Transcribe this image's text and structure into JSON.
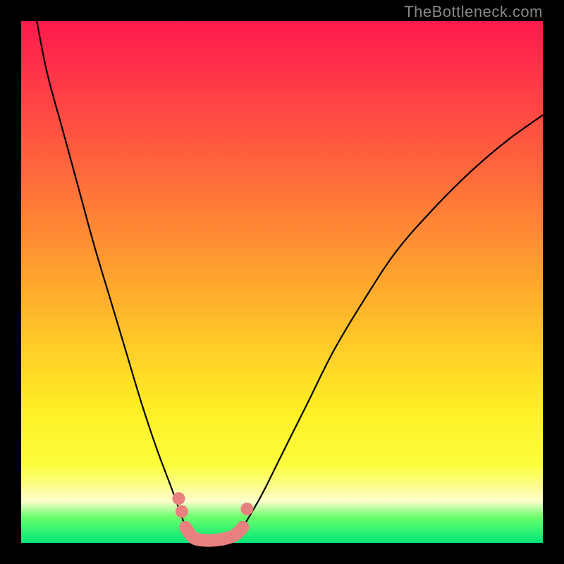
{
  "watermark": "TheBottleneck.com",
  "colors": {
    "frame": "#000000",
    "gradient_top": "#ff1a4d",
    "gradient_mid": "#ffce28",
    "gradient_bottom": "#00e676",
    "curve": "#000000",
    "marker": "#e98080"
  },
  "chart_data": {
    "type": "line",
    "title": "",
    "xlabel": "",
    "ylabel": "",
    "xlim": [
      0,
      100
    ],
    "ylim": [
      0,
      100
    ],
    "legend": false,
    "grid": false,
    "series": [
      {
        "name": "left-branch",
        "x": [
          3,
          5,
          8,
          11,
          14,
          17,
          20,
          23,
          26,
          29,
          31.5
        ],
        "values": [
          100,
          90,
          79,
          68,
          57,
          47,
          37,
          27,
          18,
          10,
          3
        ]
      },
      {
        "name": "valley-floor",
        "x": [
          31.5,
          33,
          35,
          37,
          39,
          41,
          42.5
        ],
        "values": [
          3,
          1,
          0.5,
          0.5,
          0.8,
          1.5,
          3
        ]
      },
      {
        "name": "right-branch",
        "x": [
          42.5,
          46,
          50,
          55,
          60,
          66,
          72,
          79,
          86,
          93,
          100
        ],
        "values": [
          3,
          9,
          17,
          27,
          37,
          47,
          56,
          64,
          71,
          77,
          82
        ]
      }
    ],
    "annotations": [
      {
        "name": "marker-dots-left",
        "x": 30.2,
        "y": 8.5
      },
      {
        "name": "marker-dots-left",
        "x": 30.8,
        "y": 6.0
      },
      {
        "name": "marker-dots-right",
        "x": 43.3,
        "y": 6.5
      }
    ],
    "valley_marker_path_x": [
      31.5,
      33,
      35,
      37,
      39,
      41,
      42.5
    ],
    "valley_marker_path_values": [
      3,
      1,
      0.5,
      0.5,
      0.8,
      1.5,
      3
    ]
  }
}
